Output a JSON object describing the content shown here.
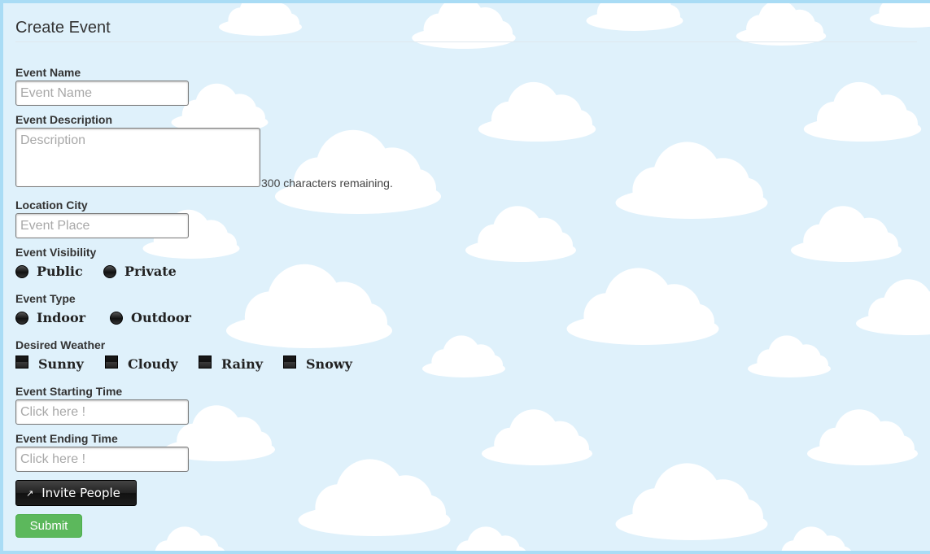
{
  "form": {
    "title": "Create Event",
    "event_name": {
      "label": "Event Name",
      "placeholder": "Event Name"
    },
    "event_description": {
      "label": "Event Description",
      "placeholder": "Description",
      "counter": "300 characters remaining."
    },
    "location_city": {
      "label": "Location City",
      "placeholder": "Event Place"
    },
    "visibility": {
      "label": "Event Visibility",
      "options": [
        "Public",
        "Private"
      ]
    },
    "type": {
      "label": "Event Type",
      "options": [
        "Indoor",
        "Outdoor"
      ]
    },
    "weather": {
      "label": "Desired Weather",
      "options": [
        "Sunny",
        "Cloudy",
        "Rainy",
        "Snowy"
      ]
    },
    "start_time": {
      "label": "Event Starting Time",
      "placeholder": "Click here !"
    },
    "end_time": {
      "label": "Event Ending Time",
      "placeholder": "Click here !"
    },
    "invite_label": "Invite People",
    "submit_label": "Submit"
  },
  "icons": {
    "invite": "external-link-icon"
  },
  "colors": {
    "sky": "#dff1fb",
    "submit": "#5cb85c",
    "frame": "#a9dcf5"
  }
}
